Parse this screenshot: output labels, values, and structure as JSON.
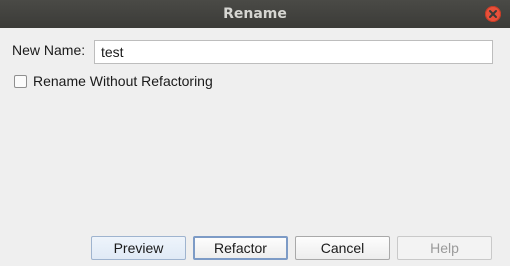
{
  "window": {
    "title": "Rename"
  },
  "form": {
    "new_name_label": "New Name:",
    "new_name_value": "test",
    "rename_without_refactoring_label": "Rename Without Refactoring",
    "rename_without_refactoring_checked": false
  },
  "buttons": {
    "preview": "Preview",
    "refactor": "Refactor",
    "cancel": "Cancel",
    "help": "Help"
  },
  "colors": {
    "titlebar": "#3f3f3c",
    "close": "#e9503a",
    "dialog_bg": "#efefef"
  },
  "icons": {
    "close": "close-icon"
  }
}
